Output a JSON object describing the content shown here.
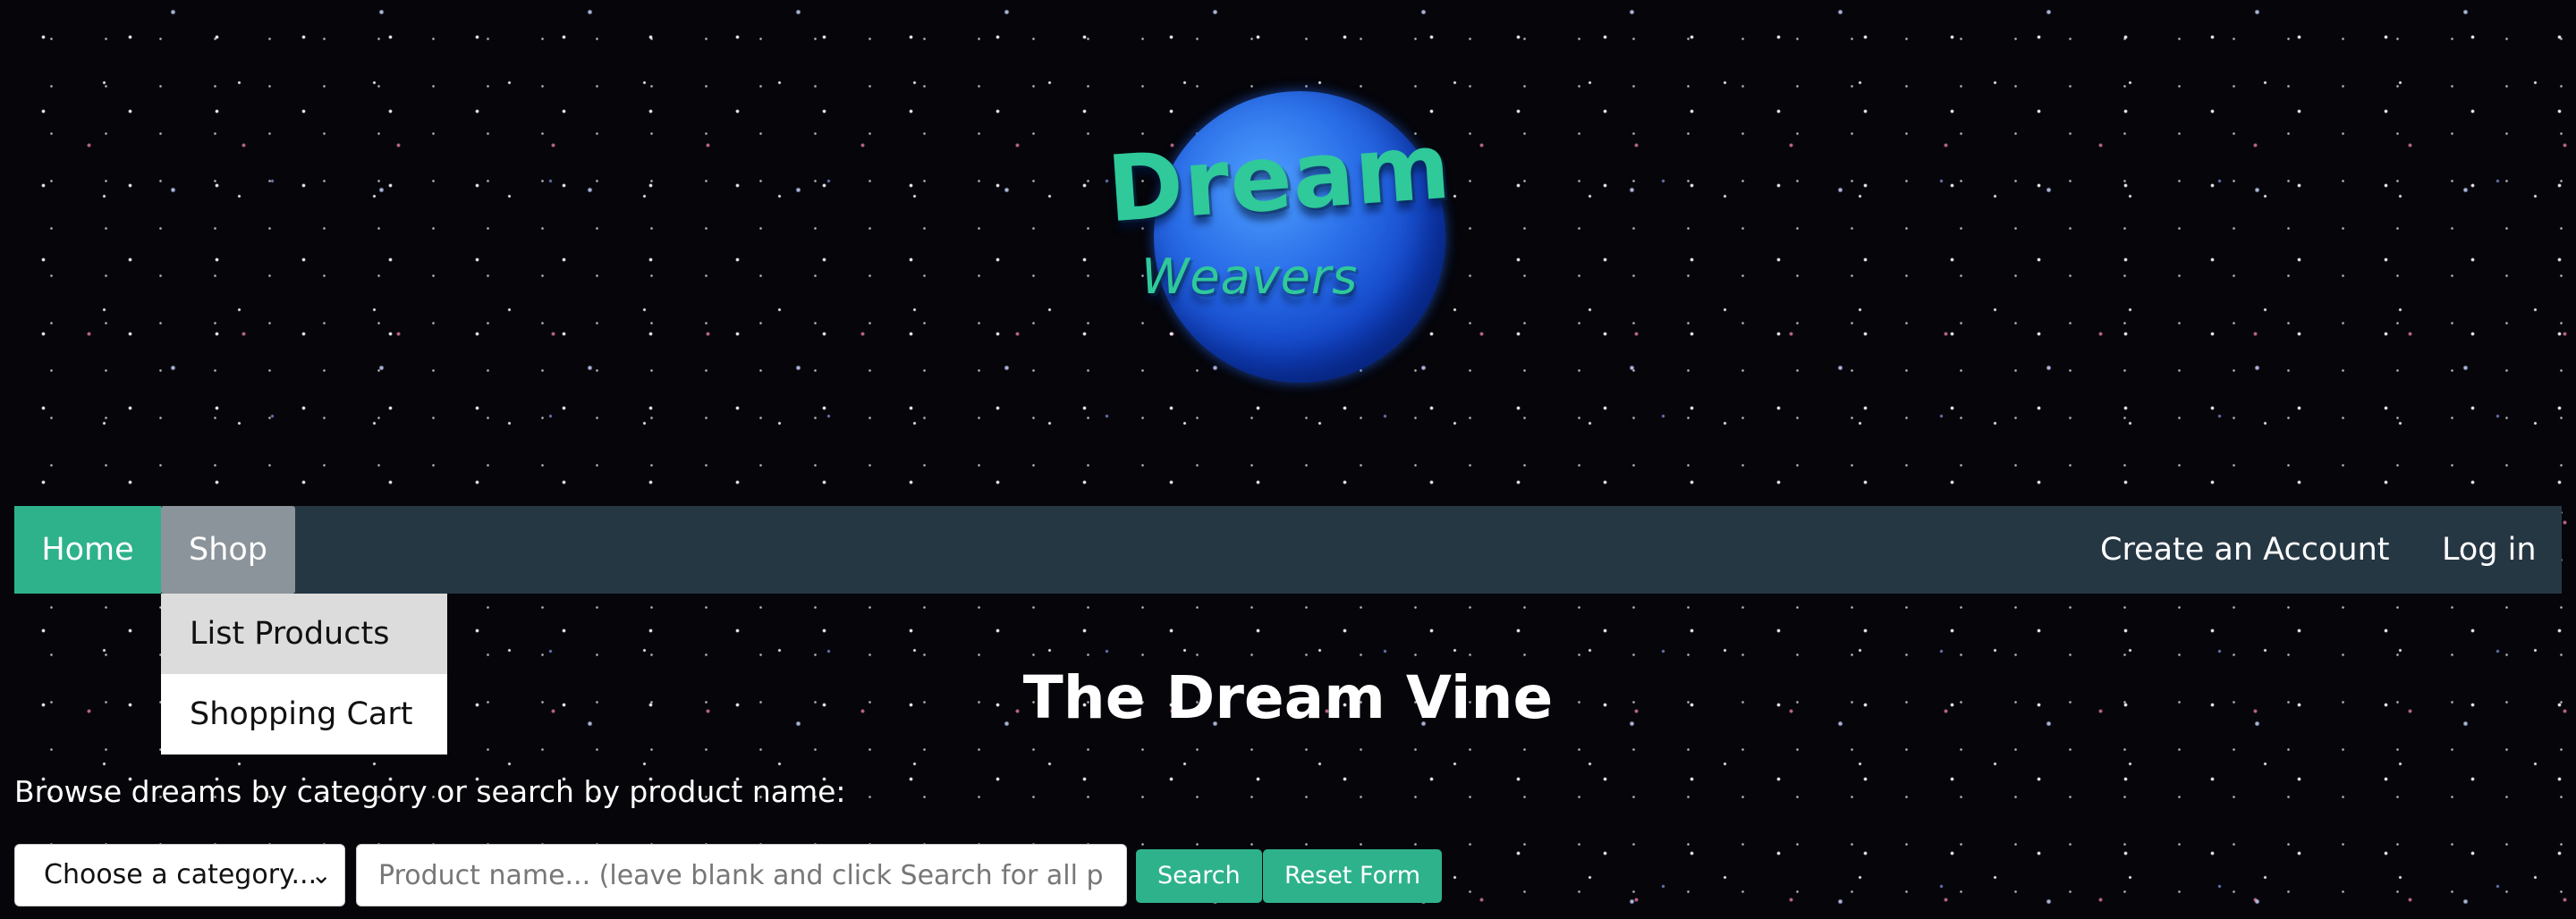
{
  "logo": {
    "line1": "Dream",
    "line2": "Weavers"
  },
  "nav": {
    "home": "Home",
    "shop": "Shop",
    "create_account": "Create an Account",
    "login": "Log in"
  },
  "shop_menu": {
    "items": [
      "List Products",
      "Shopping Cart"
    ]
  },
  "page": {
    "title": "The Dream Vine",
    "browse_text": "Browse dreams by category or search by product name:"
  },
  "search_form": {
    "category_value": "Choose a category...",
    "product_placeholder": "Product name... (leave blank and click Search for all products)",
    "search_label": "Search",
    "reset_label": "Reset Form"
  },
  "colors": {
    "accent": "#2eb28b",
    "navbar": "#263744",
    "shop_active": "#8b949a"
  }
}
